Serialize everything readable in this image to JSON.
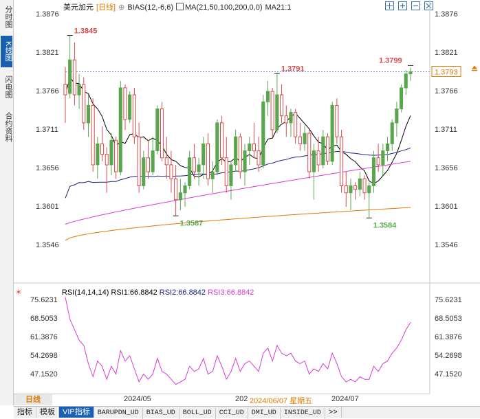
{
  "sidebar": {
    "tabs": [
      {
        "label": "分时图",
        "active": false
      },
      {
        "label": "K线图",
        "active": true
      },
      {
        "label": "闪电图",
        "active": false
      },
      {
        "label": "合约资料",
        "active": false
      }
    ]
  },
  "header": {
    "symbol": "美元加元",
    "period": "[日线]",
    "indicator1": "BIAS(12,-6,6)",
    "indicator2": "MA(21,50,100,200,0,0)",
    "indicator3": "MA21:1"
  },
  "price_axis": {
    "labels": [
      "1.3876",
      "1.3821",
      "1.3766",
      "1.3711",
      "1.3656",
      "1.3601",
      "1.3546"
    ],
    "current_price": "1.3793"
  },
  "annotations": {
    "high1": "1.3845",
    "high2": "1.3791",
    "high3": "1.3799",
    "low1": "1.3587",
    "low2": "1.3584"
  },
  "rsi": {
    "title": "RSI(14,14,14)",
    "rsi1": "RSI1:66.8842",
    "rsi2": "RSI2:66.8842",
    "rsi3": "RSI3:66.8842",
    "axis_labels": [
      "75.6231",
      "68.5053",
      "61.3876",
      "54.2698",
      "47.1520"
    ]
  },
  "timebar": {
    "period_label": "日线",
    "label1": "2024/05",
    "label2_prefix": "202",
    "label2_date": "2024/06/07 星期五",
    "label3": "2024/07"
  },
  "bottom_tabs": [
    "指标",
    "模板",
    "VIP指标",
    "BARUPDN_UD",
    "BIAS_UD",
    "BOLL_UD",
    "CCI_UD",
    "DMI_UD",
    "INSIDE_UD",
    ">>"
  ],
  "colors": {
    "up": "#5aa64f",
    "down": "#d84a4a",
    "ma1": "#000000",
    "ma2": "#1a237e",
    "ma3": "#d63cd6",
    "ma4": "#e07a00",
    "rsi_line": "#d63cd6",
    "accent": "#1b5fb3"
  },
  "chart_data": {
    "type": "candlestick",
    "ylim": [
      1.353,
      1.388
    ],
    "candles": [
      {
        "o": 1.3775,
        "h": 1.38,
        "l": 1.372,
        "c": 1.376
      },
      {
        "o": 1.3762,
        "h": 1.3845,
        "l": 1.3755,
        "c": 1.381
      },
      {
        "o": 1.381,
        "h": 1.3835,
        "l": 1.3745,
        "c": 1.376
      },
      {
        "o": 1.376,
        "h": 1.379,
        "l": 1.374,
        "c": 1.3775
      },
      {
        "o": 1.3775,
        "h": 1.3785,
        "l": 1.371,
        "c": 1.372
      },
      {
        "o": 1.372,
        "h": 1.376,
        "l": 1.37,
        "c": 1.3745
      },
      {
        "o": 1.3745,
        "h": 1.3755,
        "l": 1.365,
        "c": 1.366
      },
      {
        "o": 1.366,
        "h": 1.37,
        "l": 1.364,
        "c": 1.369
      },
      {
        "o": 1.369,
        "h": 1.3715,
        "l": 1.3665,
        "c": 1.3675
      },
      {
        "o": 1.3675,
        "h": 1.3685,
        "l": 1.362,
        "c": 1.366
      },
      {
        "o": 1.366,
        "h": 1.3705,
        "l": 1.3645,
        "c": 1.3695
      },
      {
        "o": 1.3695,
        "h": 1.37,
        "l": 1.364,
        "c": 1.365
      },
      {
        "o": 1.365,
        "h": 1.378,
        "l": 1.3645,
        "c": 1.377
      },
      {
        "o": 1.377,
        "h": 1.3775,
        "l": 1.371,
        "c": 1.3725
      },
      {
        "o": 1.3725,
        "h": 1.3765,
        "l": 1.372,
        "c": 1.376
      },
      {
        "o": 1.376,
        "h": 1.377,
        "l": 1.369,
        "c": 1.37
      },
      {
        "o": 1.37,
        "h": 1.372,
        "l": 1.362,
        "c": 1.363
      },
      {
        "o": 1.363,
        "h": 1.368,
        "l": 1.3625,
        "c": 1.367
      },
      {
        "o": 1.367,
        "h": 1.3695,
        "l": 1.364,
        "c": 1.365
      },
      {
        "o": 1.365,
        "h": 1.37,
        "l": 1.3645,
        "c": 1.368
      },
      {
        "o": 1.368,
        "h": 1.3745,
        "l": 1.3675,
        "c": 1.374
      },
      {
        "o": 1.374,
        "h": 1.375,
        "l": 1.3665,
        "c": 1.367
      },
      {
        "o": 1.367,
        "h": 1.37,
        "l": 1.364,
        "c": 1.366
      },
      {
        "o": 1.366,
        "h": 1.368,
        "l": 1.362,
        "c": 1.364
      },
      {
        "o": 1.364,
        "h": 1.366,
        "l": 1.3587,
        "c": 1.361
      },
      {
        "o": 1.361,
        "h": 1.364,
        "l": 1.3595,
        "c": 1.362
      },
      {
        "o": 1.362,
        "h": 1.3635,
        "l": 1.36,
        "c": 1.363
      },
      {
        "o": 1.363,
        "h": 1.368,
        "l": 1.3625,
        "c": 1.367
      },
      {
        "o": 1.367,
        "h": 1.369,
        "l": 1.364,
        "c": 1.365
      },
      {
        "o": 1.365,
        "h": 1.367,
        "l": 1.363,
        "c": 1.366
      },
      {
        "o": 1.366,
        "h": 1.37,
        "l": 1.364,
        "c": 1.369
      },
      {
        "o": 1.369,
        "h": 1.3705,
        "l": 1.363,
        "c": 1.364
      },
      {
        "o": 1.364,
        "h": 1.3665,
        "l": 1.362,
        "c": 1.365
      },
      {
        "o": 1.365,
        "h": 1.3725,
        "l": 1.3645,
        "c": 1.372
      },
      {
        "o": 1.372,
        "h": 1.373,
        "l": 1.366,
        "c": 1.367
      },
      {
        "o": 1.367,
        "h": 1.37,
        "l": 1.362,
        "c": 1.363
      },
      {
        "o": 1.363,
        "h": 1.3665,
        "l": 1.361,
        "c": 1.366
      },
      {
        "o": 1.366,
        "h": 1.371,
        "l": 1.365,
        "c": 1.37
      },
      {
        "o": 1.37,
        "h": 1.3705,
        "l": 1.364,
        "c": 1.365
      },
      {
        "o": 1.365,
        "h": 1.369,
        "l": 1.363,
        "c": 1.368
      },
      {
        "o": 1.368,
        "h": 1.37,
        "l": 1.366,
        "c": 1.369
      },
      {
        "o": 1.369,
        "h": 1.372,
        "l": 1.367,
        "c": 1.368
      },
      {
        "o": 1.368,
        "h": 1.37,
        "l": 1.365,
        "c": 1.366
      },
      {
        "o": 1.366,
        "h": 1.376,
        "l": 1.3655,
        "c": 1.375
      },
      {
        "o": 1.375,
        "h": 1.378,
        "l": 1.373,
        "c": 1.3765
      },
      {
        "o": 1.3765,
        "h": 1.377,
        "l": 1.37,
        "c": 1.371
      },
      {
        "o": 1.371,
        "h": 1.3791,
        "l": 1.3705,
        "c": 1.376
      },
      {
        "o": 1.376,
        "h": 1.3775,
        "l": 1.372,
        "c": 1.373
      },
      {
        "o": 1.373,
        "h": 1.3745,
        "l": 1.37,
        "c": 1.372
      },
      {
        "o": 1.372,
        "h": 1.374,
        "l": 1.37,
        "c": 1.3735
      },
      {
        "o": 1.3735,
        "h": 1.374,
        "l": 1.369,
        "c": 1.37
      },
      {
        "o": 1.37,
        "h": 1.372,
        "l": 1.368,
        "c": 1.369
      },
      {
        "o": 1.369,
        "h": 1.3715,
        "l": 1.368,
        "c": 1.3705
      },
      {
        "o": 1.3705,
        "h": 1.371,
        "l": 1.364,
        "c": 1.365
      },
      {
        "o": 1.365,
        "h": 1.369,
        "l": 1.361,
        "c": 1.368
      },
      {
        "o": 1.368,
        "h": 1.37,
        "l": 1.365,
        "c": 1.366
      },
      {
        "o": 1.366,
        "h": 1.371,
        "l": 1.3655,
        "c": 1.37
      },
      {
        "o": 1.37,
        "h": 1.3705,
        "l": 1.366,
        "c": 1.3665
      },
      {
        "o": 1.3665,
        "h": 1.375,
        "l": 1.366,
        "c": 1.3745
      },
      {
        "o": 1.3745,
        "h": 1.3755,
        "l": 1.369,
        "c": 1.37
      },
      {
        "o": 1.37,
        "h": 1.371,
        "l": 1.362,
        "c": 1.363
      },
      {
        "o": 1.363,
        "h": 1.365,
        "l": 1.36,
        "c": 1.362
      },
      {
        "o": 1.362,
        "h": 1.364,
        "l": 1.3595,
        "c": 1.363
      },
      {
        "o": 1.363,
        "h": 1.3635,
        "l": 1.361,
        "c": 1.3625
      },
      {
        "o": 1.3625,
        "h": 1.365,
        "l": 1.3615,
        "c": 1.364
      },
      {
        "o": 1.364,
        "h": 1.3645,
        "l": 1.361,
        "c": 1.362
      },
      {
        "o": 1.362,
        "h": 1.3635,
        "l": 1.3584,
        "c": 1.363
      },
      {
        "o": 1.363,
        "h": 1.368,
        "l": 1.362,
        "c": 1.367
      },
      {
        "o": 1.367,
        "h": 1.369,
        "l": 1.365,
        "c": 1.366
      },
      {
        "o": 1.366,
        "h": 1.369,
        "l": 1.3645,
        "c": 1.368
      },
      {
        "o": 1.368,
        "h": 1.37,
        "l": 1.3665,
        "c": 1.369
      },
      {
        "o": 1.369,
        "h": 1.3725,
        "l": 1.368,
        "c": 1.372
      },
      {
        "o": 1.372,
        "h": 1.375,
        "l": 1.37,
        "c": 1.374
      },
      {
        "o": 1.374,
        "h": 1.3775,
        "l": 1.3735,
        "c": 1.377
      },
      {
        "o": 1.377,
        "h": 1.3795,
        "l": 1.376,
        "c": 1.379
      },
      {
        "o": 1.379,
        "h": 1.3799,
        "l": 1.378,
        "c": 1.3793
      }
    ],
    "rsi_ylim": [
      44.0,
      78.0
    ],
    "rsi_values": [
      76.5,
      68,
      64,
      60,
      58,
      51,
      46,
      52,
      50,
      45,
      50,
      47,
      56,
      52,
      54,
      49,
      44,
      47,
      45,
      47,
      53,
      48,
      47,
      45,
      43,
      44,
      45,
      50,
      48,
      49,
      53,
      47,
      48,
      54,
      50,
      45,
      48,
      53,
      48,
      51,
      52,
      50,
      48,
      55,
      57,
      52,
      58,
      55,
      54,
      55,
      52,
      51,
      52,
      47,
      49,
      48,
      51,
      49,
      55,
      51,
      46,
      44,
      45,
      44,
      46,
      45,
      45,
      50,
      48,
      51,
      52,
      55,
      57,
      60,
      64,
      66.88
    ]
  }
}
